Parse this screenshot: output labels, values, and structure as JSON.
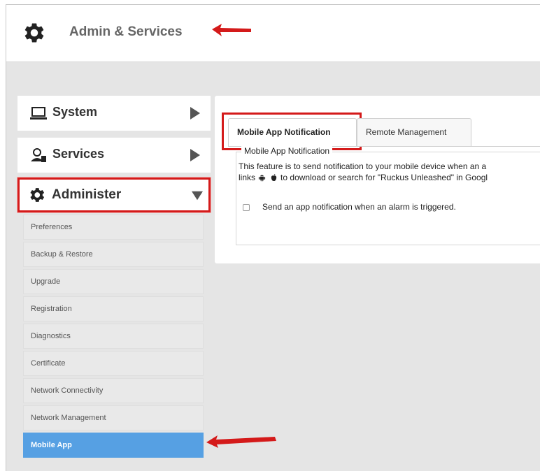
{
  "header": {
    "title": "Admin & Services",
    "icon": "gear-icon"
  },
  "sidebar": {
    "sections": [
      {
        "label": "System",
        "icon": "laptop-icon",
        "state": "collapsed"
      },
      {
        "label": "Services",
        "icon": "services-icon",
        "state": "collapsed"
      },
      {
        "label": "Administer",
        "icon": "gear-icon",
        "state": "expanded"
      }
    ],
    "sub_items": [
      {
        "label": "Preferences"
      },
      {
        "label": "Backup & Restore"
      },
      {
        "label": "Upgrade"
      },
      {
        "label": "Registration"
      },
      {
        "label": "Diagnostics"
      },
      {
        "label": "Certificate"
      },
      {
        "label": "Network Connectivity"
      },
      {
        "label": "Network Management"
      },
      {
        "label": "Mobile App",
        "active": true
      }
    ]
  },
  "content": {
    "tabs": [
      {
        "label": "Mobile App Notification",
        "active": true
      },
      {
        "label": "Remote Management"
      }
    ],
    "legend": "Mobile App Notification",
    "description_line1": "This feature is to send notification to your mobile device when an a",
    "description_line2_prefix": "links",
    "description_line2_suffix": "to download or search for \"Ruckus Unleashed\" in Googl",
    "inline_icons": [
      "android-icon",
      "apple-icon"
    ],
    "checkbox_label": "Send an app notification when an alarm is triggered.",
    "checkbox_checked": false
  },
  "colors": {
    "annotation_red": "#d41a1a",
    "active_blue": "#56a0e3",
    "frame_gray": "#e5e5e5"
  }
}
